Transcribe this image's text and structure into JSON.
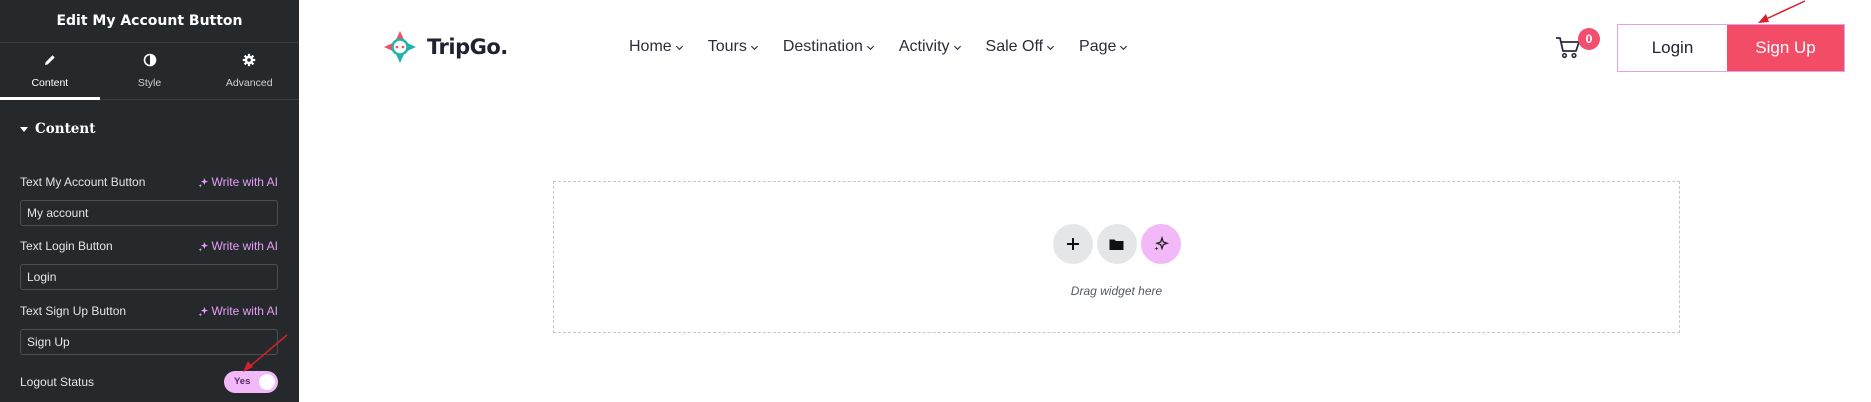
{
  "panel": {
    "title": "Edit My Account Button",
    "tabs": [
      {
        "label": "Content",
        "icon": "pencil-icon",
        "active": true
      },
      {
        "label": "Style",
        "icon": "half-circle-icon",
        "active": false
      },
      {
        "label": "Advanced",
        "icon": "gear-icon",
        "active": false
      }
    ],
    "section_title": "Content",
    "controls": [
      {
        "label": "Text My Account Button",
        "ai_label": "Write with AI",
        "value": "My account"
      },
      {
        "label": "Text Login Button",
        "ai_label": "Write with AI",
        "value": "Login"
      },
      {
        "label": "Text Sign Up Button",
        "ai_label": "Write with AI",
        "value": "Sign Up"
      }
    ],
    "logout": {
      "label": "Logout Status",
      "toggle_text": "Yes",
      "on": true
    }
  },
  "site": {
    "logo_text": "TripGo.",
    "nav": [
      "Home",
      "Tours",
      "Destination",
      "Activity",
      "Sale Off",
      "Page"
    ],
    "cart_count": "0",
    "login_label": "Login",
    "signup_label": "Sign Up"
  },
  "drop_area": {
    "hint": "Drag widget here"
  },
  "colors": {
    "panel_bg": "#26292c",
    "accent_pink": "#f3b8f7",
    "signup_red": "#f24c66",
    "badge_red": "#f0506e"
  }
}
